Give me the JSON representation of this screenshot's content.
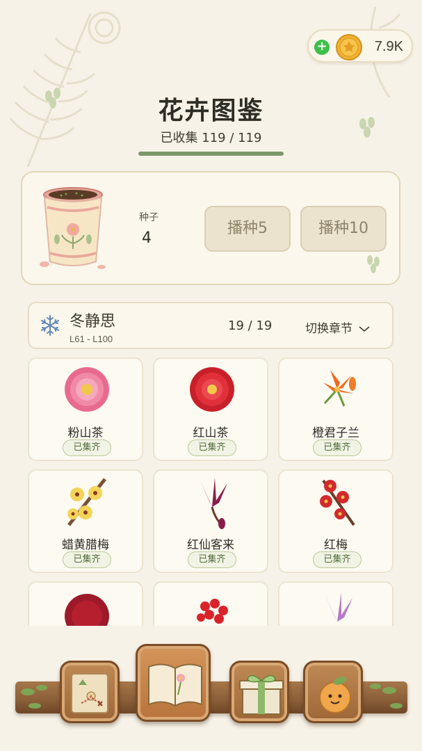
{
  "currency": {
    "amount": "7.9K",
    "plus_symbol": "+"
  },
  "header": {
    "title": "花卉图鉴",
    "collected": "已收集 119 / 119"
  },
  "seeds": {
    "label": "种子",
    "count": "4",
    "sow5_label": "播种5",
    "sow10_label": "播种10"
  },
  "chapter": {
    "name": "冬静思",
    "levels": "L61 - L100",
    "progress": "19 / 19",
    "switch_label": "切换章节",
    "switch_icon": "chevron-down"
  },
  "flowers": [
    {
      "name": "粉山茶",
      "status": "已集齐"
    },
    {
      "name": "红山茶",
      "status": "已集齐"
    },
    {
      "name": "橙君子兰",
      "status": "已集齐"
    },
    {
      "name": "蜡黄腊梅",
      "status": "已集齐"
    },
    {
      "name": "红仙客来",
      "status": "已集齐"
    },
    {
      "name": "红梅",
      "status": "已集齐"
    }
  ],
  "nav": {
    "items": [
      "map-icon",
      "book-icon",
      "gift-icon",
      "character-icon"
    ],
    "active": "book-icon"
  },
  "colors": {
    "accent_green": "#7c9868",
    "badge_text": "#4f6b3a",
    "wood": "#9c6637",
    "background": "#f7f2e8"
  }
}
